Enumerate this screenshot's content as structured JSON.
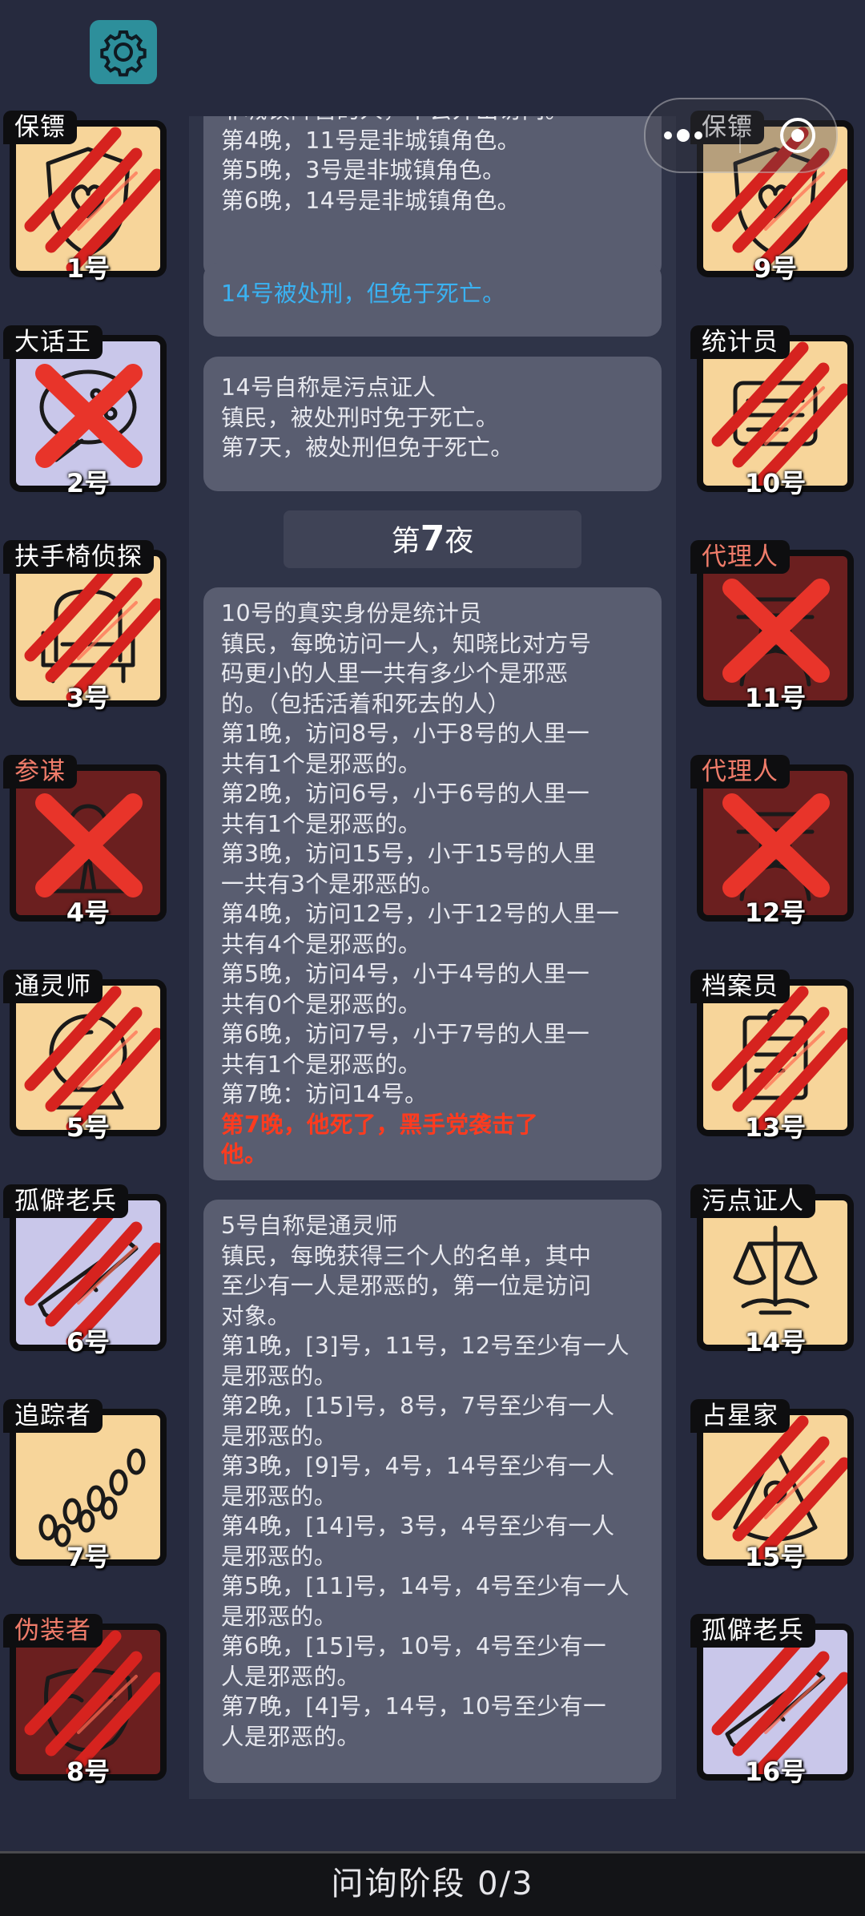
{
  "phase": {
    "label": "问询阶段 0/3"
  },
  "players": [
    {
      "num": "1号",
      "role": "保镖",
      "tag_style": "good",
      "tile": "good",
      "icon": "shield-icon",
      "mark": "claw"
    },
    {
      "num": "2号",
      "role": "大话王",
      "tag_style": "good",
      "tile": "out",
      "icon": "bubble-icon",
      "mark": "cross"
    },
    {
      "num": "3号",
      "role": "扶手椅侦探",
      "tag_style": "good",
      "tile": "good",
      "icon": "armchair-icon",
      "mark": "claw"
    },
    {
      "num": "4号",
      "role": "参谋",
      "tag_style": "evil",
      "tile": "evil",
      "icon": "advisor-icon",
      "mark": "cross"
    },
    {
      "num": "5号",
      "role": "通灵师",
      "tag_style": "good",
      "tile": "good",
      "icon": "crystal-ball-icon",
      "mark": "claw"
    },
    {
      "num": "6号",
      "role": "孤僻老兵",
      "tag_style": "good",
      "tile": "out",
      "icon": "rifle-icon",
      "mark": "claw"
    },
    {
      "num": "7号",
      "role": "追踪者",
      "tag_style": "good",
      "tile": "good",
      "icon": "footprints-icon",
      "mark": "none"
    },
    {
      "num": "8号",
      "role": "伪装者",
      "tag_style": "evil",
      "tile": "evil",
      "icon": "mask-icon",
      "mark": "claw"
    },
    {
      "num": "9号",
      "role": "保镖",
      "tag_style": "good",
      "tile": "good",
      "icon": "shield-icon",
      "mark": "claw"
    },
    {
      "num": "10号",
      "role": "统计员",
      "tag_style": "good",
      "tile": "good",
      "icon": "ledger-icon",
      "mark": "claw"
    },
    {
      "num": "11号",
      "role": "代理人",
      "tag_style": "evil",
      "tile": "evil",
      "icon": "agent-icon",
      "mark": "cross"
    },
    {
      "num": "12号",
      "role": "代理人",
      "tag_style": "evil",
      "tile": "evil",
      "icon": "agent-icon",
      "mark": "cross"
    },
    {
      "num": "13号",
      "role": "档案员",
      "tag_style": "good",
      "tile": "good",
      "icon": "archive-icon",
      "mark": "claw"
    },
    {
      "num": "14号",
      "role": "污点证人",
      "tag_style": "good",
      "tile": "good",
      "icon": "scales-icon",
      "mark": "none"
    },
    {
      "num": "15号",
      "role": "占星家",
      "tag_style": "good",
      "tile": "good",
      "icon": "sextant-icon",
      "mark": "claw"
    },
    {
      "num": "16号",
      "role": "孤僻老兵",
      "tag_style": "good",
      "tile": "out",
      "icon": "rifle-icon",
      "mark": "claw"
    }
  ],
  "log": {
    "entry1": [
      "非城镇阵营的人，不会外出访问。",
      "第4晚，11号是非城镇角色。",
      "第5晚，3号是非城镇角色。",
      "第6晚，14号是非城镇角色。"
    ],
    "entry2": "14号被处刑，但免于死亡。",
    "entry3": [
      "14号自称是污点证人",
      "镇民，被处刑时免于死亡。",
      "第7天，被处刑但免于死亡。"
    ],
    "night_prefix": "第",
    "night_num": "7",
    "night_suffix": "夜",
    "entry4": [
      "10号的真实身份是统计员",
      "镇民，每晚访问一人，知晓比对方号",
      "码更小的人里一共有多少个是邪恶",
      "的。（包括活着和死去的人）",
      "第1晚，访问8号，小于8号的人里一",
      "共有1个是邪恶的。",
      "第2晚，访问6号，小于6号的人里一",
      "共有1个是邪恶的。",
      "第3晚，访问15号，小于15号的人里",
      "一共有3个是邪恶的。",
      "第4晚，访问12号，小于12号的人里一",
      "共有4个是邪恶的。",
      "第5晚，访问4号，小于4号的人里一",
      "共有0个是邪恶的。",
      "第6晚，访问7号，小于7号的人里一",
      "共有1个是邪恶的。",
      "第7晚：访问14号。"
    ],
    "entry4_red": [
      "第7晚，他死了，黑手党袭击了",
      "他。"
    ],
    "entry5": [
      "5号自称是通灵师",
      "镇民，每晚获得三个人的名单，其中",
      "至少有一人是邪恶的，第一位是访问",
      "对象。",
      "第1晚，[3]号，11号，12号至少有一人",
      "是邪恶的。",
      "第2晚，[15]号，8号，7号至少有一人",
      "是邪恶的。",
      "第3晚，[9]号，4号，14号至少有一人",
      "是邪恶的。",
      "第4晚，[14]号，3号，4号至少有一人",
      "是邪恶的。",
      "第5晚，[11]号，14号，4号至少有一人",
      "是邪恶的。",
      "第6晚，[15]号，10号，4号至少有一",
      "人是邪恶的。",
      "第7晚，[4]号，14号，10号至少有一",
      "人是邪恶的。"
    ]
  },
  "colors": {
    "claw": "#d6231f",
    "cross": "#e8342a",
    "blue_text": "#3ab2f2",
    "red_text": "#ff3b1f"
  }
}
